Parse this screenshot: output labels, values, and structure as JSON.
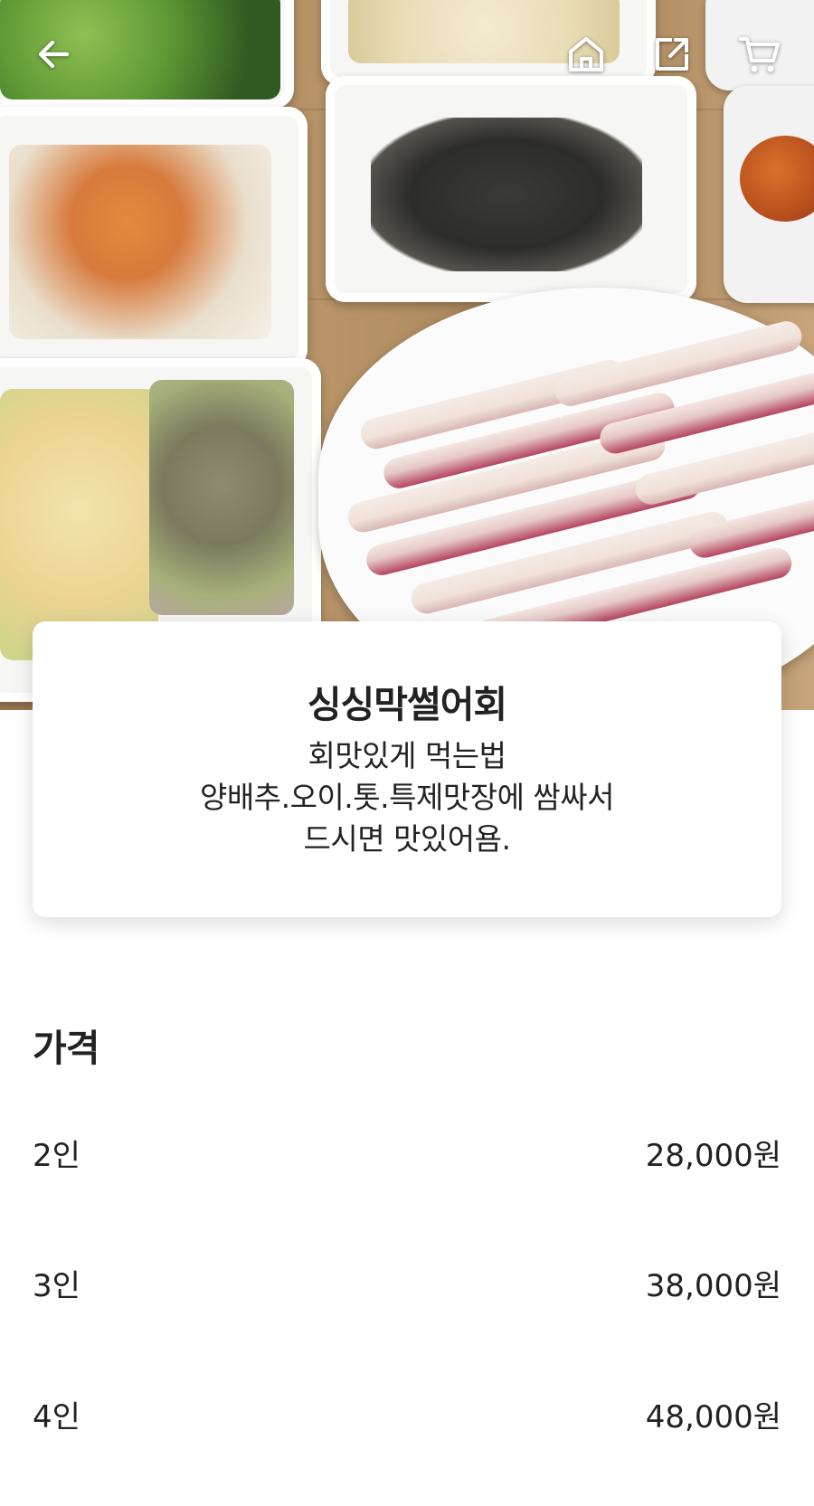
{
  "header": {
    "back_icon": "arrow-left-icon",
    "home_icon": "home-icon",
    "share_icon": "share-icon",
    "cart_icon": "cart-icon"
  },
  "menu_item": {
    "name": "싱싱막썰어회",
    "description": "회맛있게 먹는법\n양배추.오이.톳.특제맛장에 쌈싸서\n드시면 맛있어욤."
  },
  "price_section": {
    "title": "가격",
    "options": [
      {
        "label": "2인",
        "price": "28,000원"
      },
      {
        "label": "3인",
        "price": "38,000원"
      },
      {
        "label": "4인",
        "price": "48,000원"
      }
    ]
  },
  "colors": {
    "text": "#222222",
    "background": "#ffffff"
  }
}
